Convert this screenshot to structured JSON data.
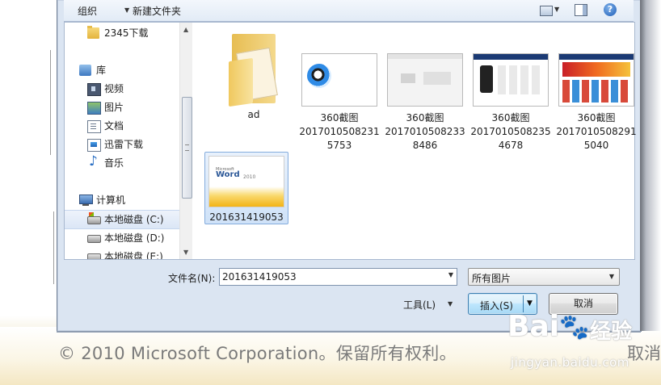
{
  "toolbar": {
    "organize": "组织",
    "new_folder": "新建文件夹",
    "help": "?"
  },
  "nav": {
    "items": [
      {
        "label": "2345下载",
        "icon": "folder-icon"
      },
      {
        "label": "库",
        "icon": "library-icon"
      },
      {
        "label": "视频",
        "icon": "video-icon"
      },
      {
        "label": "图片",
        "icon": "picture-icon"
      },
      {
        "label": "文档",
        "icon": "document-icon"
      },
      {
        "label": "迅雷下载",
        "icon": "thunder-download-icon"
      },
      {
        "label": "音乐",
        "icon": "music-icon"
      },
      {
        "label": "计算机",
        "icon": "computer-icon"
      },
      {
        "label": "本地磁盘 (C:)",
        "icon": "drive-icon",
        "selected": true
      },
      {
        "label": "本地磁盘 (D:)",
        "icon": "drive-icon"
      },
      {
        "label": "本地磁盘 (E:)",
        "icon": "drive-icon"
      }
    ]
  },
  "files": [
    {
      "name": "ad",
      "type": "folder"
    },
    {
      "name": "360截图\n20170105082315753",
      "line1": "360截图",
      "line2": "2017010508231",
      "line3": "5753",
      "type": "screenshot"
    },
    {
      "name": "360截图\n20170105082338486",
      "line1": "360截图",
      "line2": "2017010508233",
      "line3": "8486",
      "type": "screenshot"
    },
    {
      "name": "360截图\n20170105082354678",
      "line1": "360截图",
      "line2": "2017010508235",
      "line3": "4678",
      "type": "screenshot"
    },
    {
      "name": "360截图\n20170105082915040",
      "line1": "360截图",
      "line2": "2017010508291",
      "line3": "5040",
      "type": "screenshot"
    },
    {
      "name": "201631419053",
      "type": "image",
      "selected": true,
      "thumb_small": "Microsoft",
      "thumb_word": "Word",
      "thumb_year": "2010"
    }
  ],
  "filename": {
    "label": "文件名(N):",
    "value": "201631419053"
  },
  "file_type": {
    "value": "所有图片"
  },
  "buttons": {
    "tools": "工具(L)",
    "insert": "插入(S)",
    "cancel": "取消"
  },
  "background": {
    "copyright": "© 2010 Microsoft Corporation。保留所有权利。",
    "cancel_fragment": "取消"
  },
  "watermark": {
    "brand": "Bai",
    "brand_cn": "经验",
    "url": "jingyan.baidu.com"
  },
  "colors": {
    "dialog_bg": "#dbe5f2",
    "selected_bg": "#cfe2f8",
    "accent_orange": "#f3b316"
  }
}
